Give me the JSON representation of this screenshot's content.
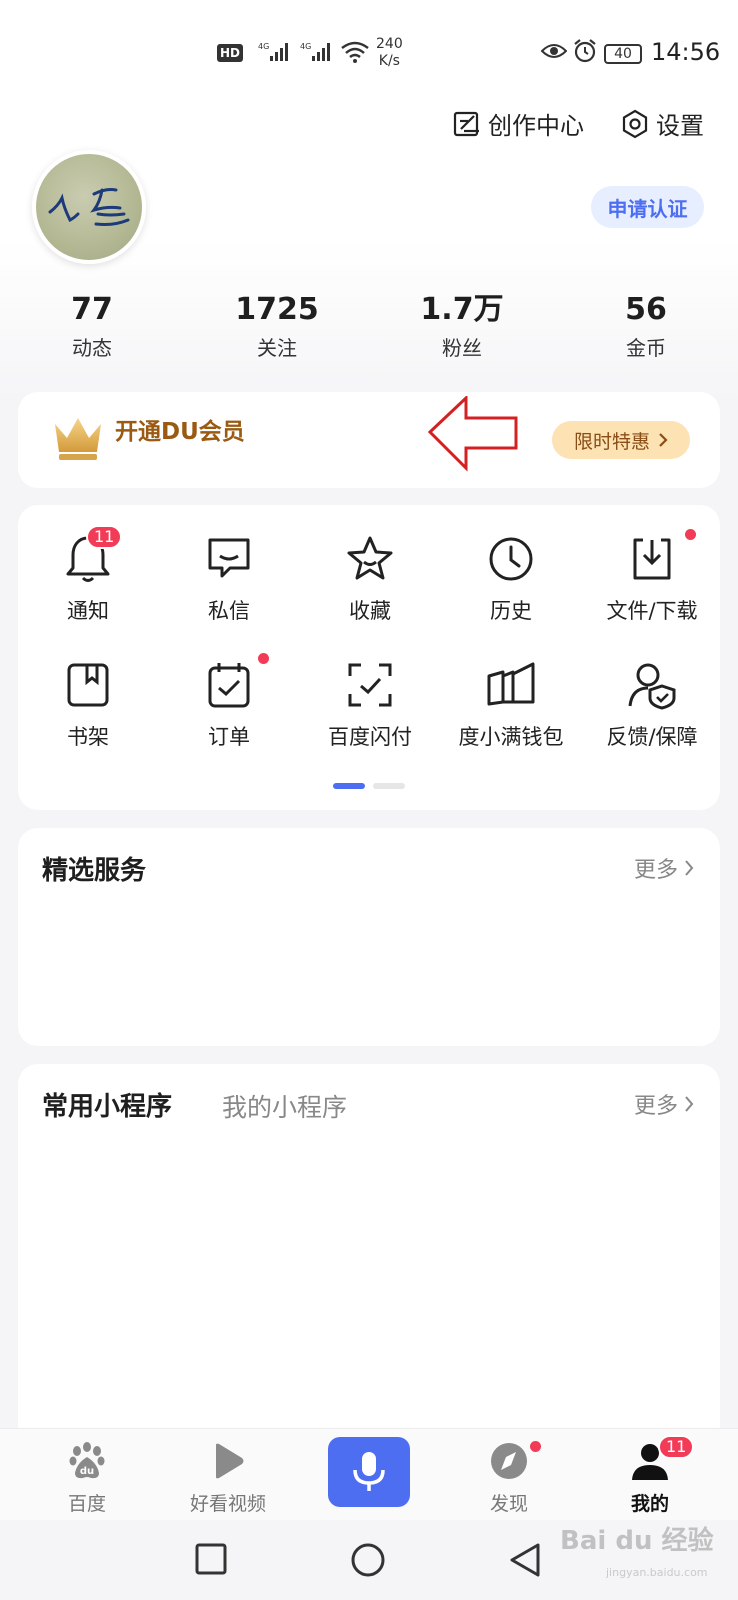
{
  "status_bar": {
    "hd": "HD",
    "net_speed_value": "240",
    "net_speed_unit": "K/s",
    "battery": "40",
    "time": "14:56"
  },
  "header": {
    "creation_center_label": "创作中心",
    "settings_label": "设置"
  },
  "profile": {
    "avatar_text": "人生",
    "certify_label": "申请认证"
  },
  "stats": [
    {
      "value": "77",
      "label": "动态"
    },
    {
      "value": "1725",
      "label": "关注"
    },
    {
      "value": "1.7万",
      "label": "粉丝"
    },
    {
      "value": "56",
      "label": "金币"
    }
  ],
  "vip": {
    "title": "开通DU会员",
    "button_label": "限时特惠"
  },
  "shortcuts": [
    {
      "label": "通知",
      "icon": "bell-icon",
      "badge": "11"
    },
    {
      "label": "私信",
      "icon": "message-icon"
    },
    {
      "label": "收藏",
      "icon": "star-icon"
    },
    {
      "label": "历史",
      "icon": "clock-icon"
    },
    {
      "label": "文件/下载",
      "icon": "download-icon",
      "dot": true
    },
    {
      "label": "书架",
      "icon": "bookshelf-icon"
    },
    {
      "label": "订单",
      "icon": "order-icon",
      "dot": true
    },
    {
      "label": "百度闪付",
      "icon": "scan-pay-icon"
    },
    {
      "label": "度小满钱包",
      "icon": "wallet-icon"
    },
    {
      "label": "反馈/保障",
      "icon": "feedback-icon"
    }
  ],
  "shortcuts_page": {
    "current": 1,
    "total": 2
  },
  "featured_services": {
    "title": "精选服务",
    "more_label": "更多"
  },
  "mini_programs": {
    "title": "常用小程序",
    "tab_mine": "我的小程序",
    "more_label": "更多"
  },
  "bottom_nav": {
    "items": [
      {
        "label": "百度",
        "icon": "baidu-paw-icon"
      },
      {
        "label": "好看视频",
        "icon": "play-icon"
      },
      {
        "label": "",
        "icon": "microphone-icon"
      },
      {
        "label": "发现",
        "icon": "compass-icon",
        "dot": true
      },
      {
        "label": "我的",
        "icon": "user-icon",
        "badge": "11",
        "active": true
      }
    ]
  },
  "watermark": {
    "text": "Bai du 经验",
    "url": "jingyan.baidu.com"
  },
  "colors": {
    "accent_blue": "#4e6ef2",
    "badge_red": "#f23c57",
    "vip_gold": "#9a5a12",
    "annotation_arrow": "#d42020"
  }
}
